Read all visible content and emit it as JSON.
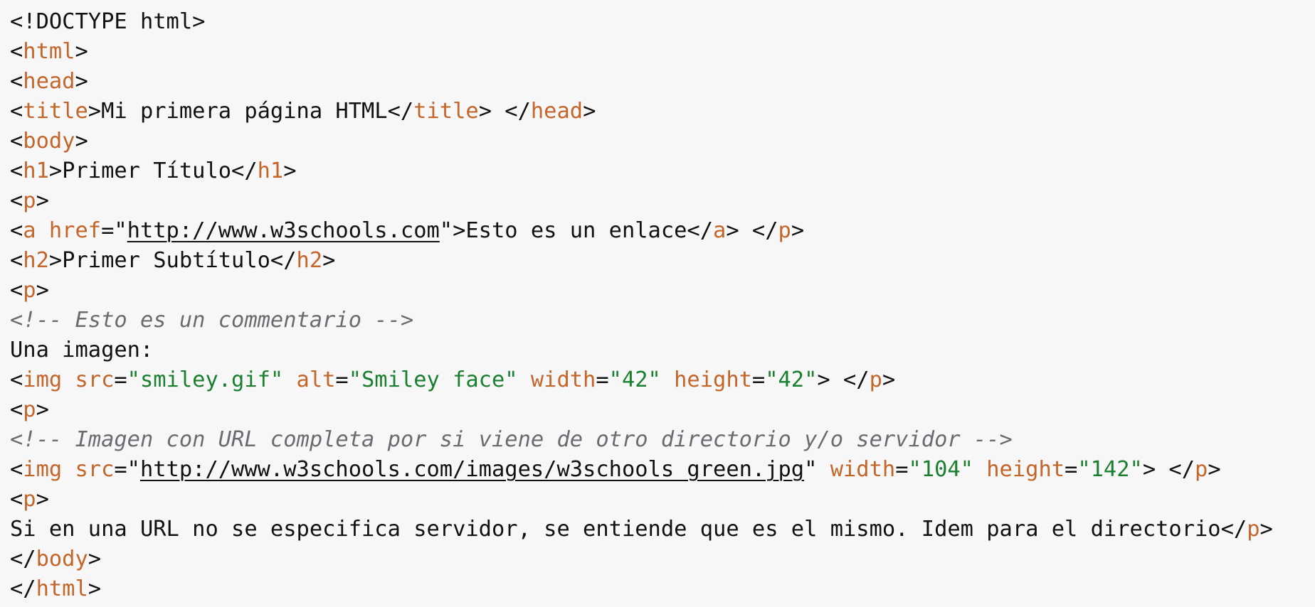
{
  "colors": {
    "background": "#f7f7f7",
    "text": "#111111",
    "tag": "#c4652a",
    "string": "#1a7f2e",
    "comment": "#6b6b72"
  },
  "code_lines": [
    [
      {
        "t": "text",
        "v": "<!DOCTYPE html>"
      }
    ],
    [
      {
        "t": "text",
        "v": "<"
      },
      {
        "t": "tag",
        "v": "html"
      },
      {
        "t": "text",
        "v": ">"
      }
    ],
    [
      {
        "t": "text",
        "v": "<"
      },
      {
        "t": "tag",
        "v": "head"
      },
      {
        "t": "text",
        "v": ">"
      }
    ],
    [
      {
        "t": "text",
        "v": "<"
      },
      {
        "t": "tag",
        "v": "title"
      },
      {
        "t": "text",
        "v": ">Mi primera página HTML</"
      },
      {
        "t": "tag",
        "v": "title"
      },
      {
        "t": "text",
        "v": "> </"
      },
      {
        "t": "tag",
        "v": "head"
      },
      {
        "t": "text",
        "v": ">"
      }
    ],
    [
      {
        "t": "text",
        "v": "<"
      },
      {
        "t": "tag",
        "v": "body"
      },
      {
        "t": "text",
        "v": ">"
      }
    ],
    [
      {
        "t": "text",
        "v": "<"
      },
      {
        "t": "tag",
        "v": "h1"
      },
      {
        "t": "text",
        "v": ">Primer Título</"
      },
      {
        "t": "tag",
        "v": "h1"
      },
      {
        "t": "text",
        "v": ">"
      }
    ],
    [
      {
        "t": "text",
        "v": "<"
      },
      {
        "t": "tag",
        "v": "p"
      },
      {
        "t": "text",
        "v": ">"
      }
    ],
    [
      {
        "t": "text",
        "v": "<"
      },
      {
        "t": "tag",
        "v": "a href"
      },
      {
        "t": "text",
        "v": "=\""
      },
      {
        "t": "url",
        "v": "http://www.w3schools.com"
      },
      {
        "t": "text",
        "v": "\">Esto es un enlace</"
      },
      {
        "t": "tag",
        "v": "a"
      },
      {
        "t": "text",
        "v": "> </"
      },
      {
        "t": "tag",
        "v": "p"
      },
      {
        "t": "text",
        "v": ">"
      }
    ],
    [
      {
        "t": "text",
        "v": "<"
      },
      {
        "t": "tag",
        "v": "h2"
      },
      {
        "t": "text",
        "v": ">Primer Subtítulo</"
      },
      {
        "t": "tag",
        "v": "h2"
      },
      {
        "t": "text",
        "v": ">"
      }
    ],
    [
      {
        "t": "text",
        "v": "<"
      },
      {
        "t": "tag",
        "v": "p"
      },
      {
        "t": "text",
        "v": ">"
      }
    ],
    [
      {
        "t": "comment",
        "v": "<!-- Esto es un commentario -->"
      }
    ],
    [
      {
        "t": "text",
        "v": "Una imagen:"
      }
    ],
    [
      {
        "t": "text",
        "v": "<"
      },
      {
        "t": "tag",
        "v": "img src"
      },
      {
        "t": "text",
        "v": "="
      },
      {
        "t": "string",
        "v": "\"smiley.gif\""
      },
      {
        "t": "text",
        "v": " "
      },
      {
        "t": "tag",
        "v": "alt"
      },
      {
        "t": "text",
        "v": "="
      },
      {
        "t": "string",
        "v": "\"Smiley face\""
      },
      {
        "t": "text",
        "v": " "
      },
      {
        "t": "tag",
        "v": "width"
      },
      {
        "t": "text",
        "v": "="
      },
      {
        "t": "string",
        "v": "\"42\""
      },
      {
        "t": "text",
        "v": " "
      },
      {
        "t": "tag",
        "v": "height"
      },
      {
        "t": "text",
        "v": "="
      },
      {
        "t": "string",
        "v": "\"42\""
      },
      {
        "t": "text",
        "v": "> </"
      },
      {
        "t": "tag",
        "v": "p"
      },
      {
        "t": "text",
        "v": ">"
      }
    ],
    [
      {
        "t": "text",
        "v": "<"
      },
      {
        "t": "tag",
        "v": "p"
      },
      {
        "t": "text",
        "v": ">"
      }
    ],
    [
      {
        "t": "comment",
        "v": "<!-- Imagen con URL completa por si viene de otro directorio y/o servidor -->"
      }
    ],
    [
      {
        "t": "text",
        "v": "<"
      },
      {
        "t": "tag",
        "v": "img src"
      },
      {
        "t": "text",
        "v": "=\""
      },
      {
        "t": "url",
        "v": "http://www.w3schools.com/images/w3schools_green.jpg"
      },
      {
        "t": "text",
        "v": "\" "
      },
      {
        "t": "tag",
        "v": "width"
      },
      {
        "t": "text",
        "v": "="
      },
      {
        "t": "string",
        "v": "\"104\""
      },
      {
        "t": "text",
        "v": " "
      },
      {
        "t": "tag",
        "v": "height"
      },
      {
        "t": "text",
        "v": "="
      },
      {
        "t": "string",
        "v": "\"142\""
      },
      {
        "t": "text",
        "v": "> </"
      },
      {
        "t": "tag",
        "v": "p"
      },
      {
        "t": "text",
        "v": ">"
      }
    ],
    [
      {
        "t": "text",
        "v": "<"
      },
      {
        "t": "tag",
        "v": "p"
      },
      {
        "t": "text",
        "v": ">"
      }
    ],
    [
      {
        "t": "text",
        "v": "Si en una URL no se especifica servidor, se entiende que es el mismo. Idem para el directorio</"
      },
      {
        "t": "tag",
        "v": "p"
      },
      {
        "t": "text",
        "v": ">"
      }
    ],
    [
      {
        "t": "text",
        "v": "</"
      },
      {
        "t": "tag",
        "v": "body"
      },
      {
        "t": "text",
        "v": ">"
      }
    ],
    [
      {
        "t": "text",
        "v": "</"
      },
      {
        "t": "tag",
        "v": "html"
      },
      {
        "t": "text",
        "v": ">"
      }
    ]
  ]
}
